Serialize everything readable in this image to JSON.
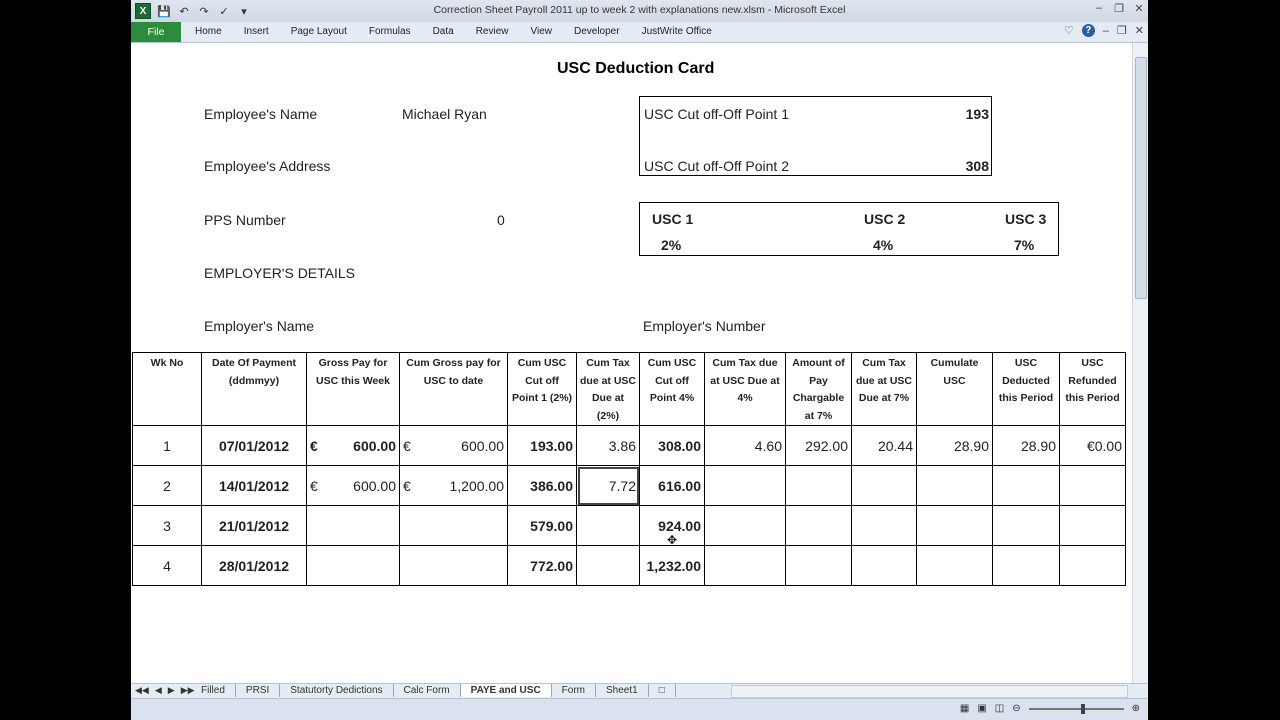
{
  "window": {
    "title": "Correction Sheet Payroll 2011 up to week 2 with explanations new.xlsm - Microsoft Excel",
    "app_icon": "X"
  },
  "ribbon": {
    "file": "File",
    "tabs": [
      "Home",
      "Insert",
      "Page Layout",
      "Formulas",
      "Data",
      "Review",
      "View",
      "Developer",
      "JustWrite Office"
    ]
  },
  "card": {
    "title": "USC Deduction Card",
    "employee_name_label": "Employee's Name",
    "employee_name": "Michael Ryan",
    "employee_address_label": "Employee's Address",
    "pps_label": "PPS Number",
    "pps_value": "0",
    "employer_details": "EMPLOYER'S DETAILS",
    "employer_name_label": "Employer's Name",
    "employer_number_label": "Employer's Number",
    "cutoff1_label": "USC Cut off-Off Point 1",
    "cutoff1_value": "193",
    "cutoff2_label": "USC Cut off-Off Point 2",
    "cutoff2_value": "308",
    "usc1": "USC 1",
    "usc1_rate": "2%",
    "usc2": "USC 2",
    "usc2_rate": "4%",
    "usc3": "USC 3",
    "usc3_rate": "7%"
  },
  "table": {
    "headers": [
      "Wk No",
      "Date Of Payment (ddmmyy)",
      "Gross Pay for USC this Week",
      "Cum Gross pay for USC to date",
      "Cum USC Cut off Point 1 (2%)",
      "Cum Tax due at USC Due at (2%)",
      "Cum USC Cut off Point 4%",
      "Cum Tax due at USC Due at 4%",
      "Amount of Pay Chargable at 7%",
      "Cum Tax due at USC Due at 7%",
      "Cumulate USC",
      "USC Deducted this Period",
      "USC Refunded this Period"
    ],
    "currency": "€",
    "rows": [
      {
        "wk": "1",
        "date": "07/01/2012",
        "gross": "600.00",
        "cum_gross": "600.00",
        "cut1": "193.00",
        "tax2": "3.86",
        "cut4": "308.00",
        "tax4": "4.60",
        "amt7": "292.00",
        "tax7": "20.44",
        "cum_usc": "28.90",
        "deducted": "28.90",
        "refunded": "€0.00"
      },
      {
        "wk": "2",
        "date": "14/01/2012",
        "gross": "600.00",
        "cum_gross": "1,200.00",
        "cut1": "386.00",
        "tax2": "7.72",
        "cut4": "616.00",
        "tax4": "",
        "amt7": "",
        "tax7": "",
        "cum_usc": "",
        "deducted": "",
        "refunded": ""
      },
      {
        "wk": "3",
        "date": "21/01/2012",
        "gross": "",
        "cum_gross": "",
        "cut1": "579.00",
        "tax2": "",
        "cut4": "924.00",
        "tax4": "",
        "amt7": "",
        "tax7": "",
        "cum_usc": "",
        "deducted": "",
        "refunded": ""
      },
      {
        "wk": "4",
        "date": "28/01/2012",
        "gross": "",
        "cum_gross": "",
        "cut1": "772.00",
        "tax2": "",
        "cut4": "1,232.00",
        "tax4": "",
        "amt7": "",
        "tax7": "",
        "cum_usc": "",
        "deducted": "",
        "refunded": ""
      }
    ]
  },
  "sheet_tabs": [
    "Filled",
    "PRSI",
    "Statutorty Dedictions",
    "Calc Form",
    "PAYE and USC",
    "Form",
    "Sheet1"
  ],
  "active_sheet": "PAYE and USC"
}
